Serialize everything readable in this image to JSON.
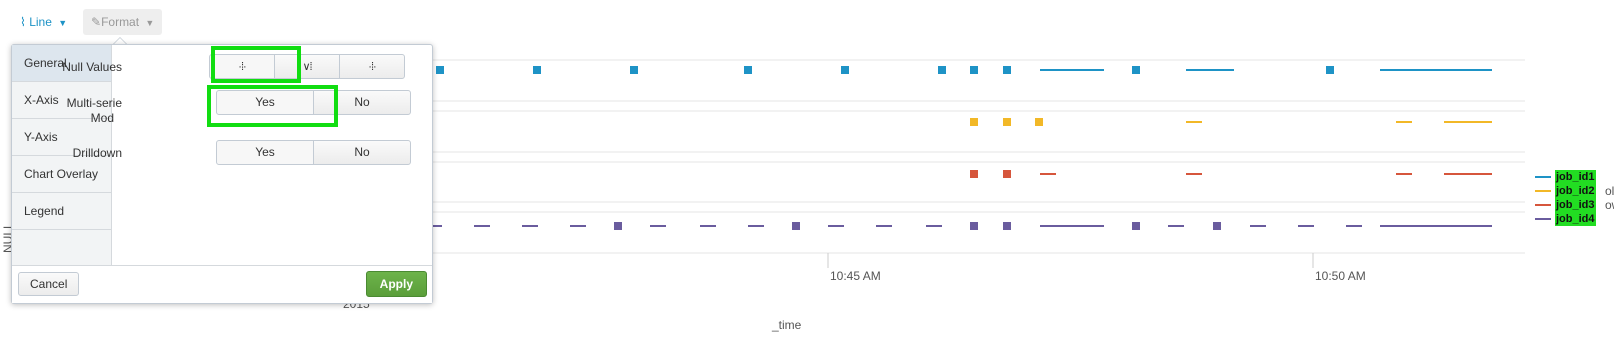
{
  "toolbar": {
    "line_label": "Line",
    "format_label": "Format"
  },
  "chart": {
    "x_title": "_time",
    "x_ticks": [
      "10:45 AM",
      "10:50 AM"
    ],
    "x_year": "2015",
    "y_title_fragment": "NULL",
    "series_colors": [
      "#1e93c6",
      "#f2b827",
      "#d6563c",
      "#6a5c9e"
    ]
  },
  "legend": {
    "items": [
      {
        "label": "job_id1",
        "color": "#1e93c6",
        "tail": ""
      },
      {
        "label": "job_id2",
        "color": "#f2b827",
        "tail": "ols"
      },
      {
        "label": "job_id3",
        "color": "#d6563c",
        "tail": "ows"
      },
      {
        "label": "job_id4",
        "color": "#6a5c9e",
        "tail": ""
      }
    ]
  },
  "popup": {
    "nav": [
      "General",
      "X-Axis",
      "Y-Axis",
      "Chart Overlay",
      "Legend"
    ],
    "null_values_label": "Null Values",
    "null_values_options": [
      "gaps-icon",
      "zero-icon",
      "connect-icon"
    ],
    "multiseries_label_1": "Multi-serie",
    "multiseries_label_2": "Mod",
    "multiseries_options": [
      "Yes",
      "No"
    ],
    "drilldown_label": "Drilldown",
    "drilldown_options": [
      "Yes",
      "No"
    ],
    "cancel": "Cancel",
    "apply": "Apply"
  },
  "chart_data": {
    "type": "line",
    "xlabel": "_time",
    "x_ticks": [
      "10:45 AM",
      "10:50 AM"
    ],
    "series": [
      {
        "name": "job_id1"
      },
      {
        "name": "job_id2"
      },
      {
        "name": "job_id3"
      },
      {
        "name": "job_id4"
      }
    ]
  }
}
